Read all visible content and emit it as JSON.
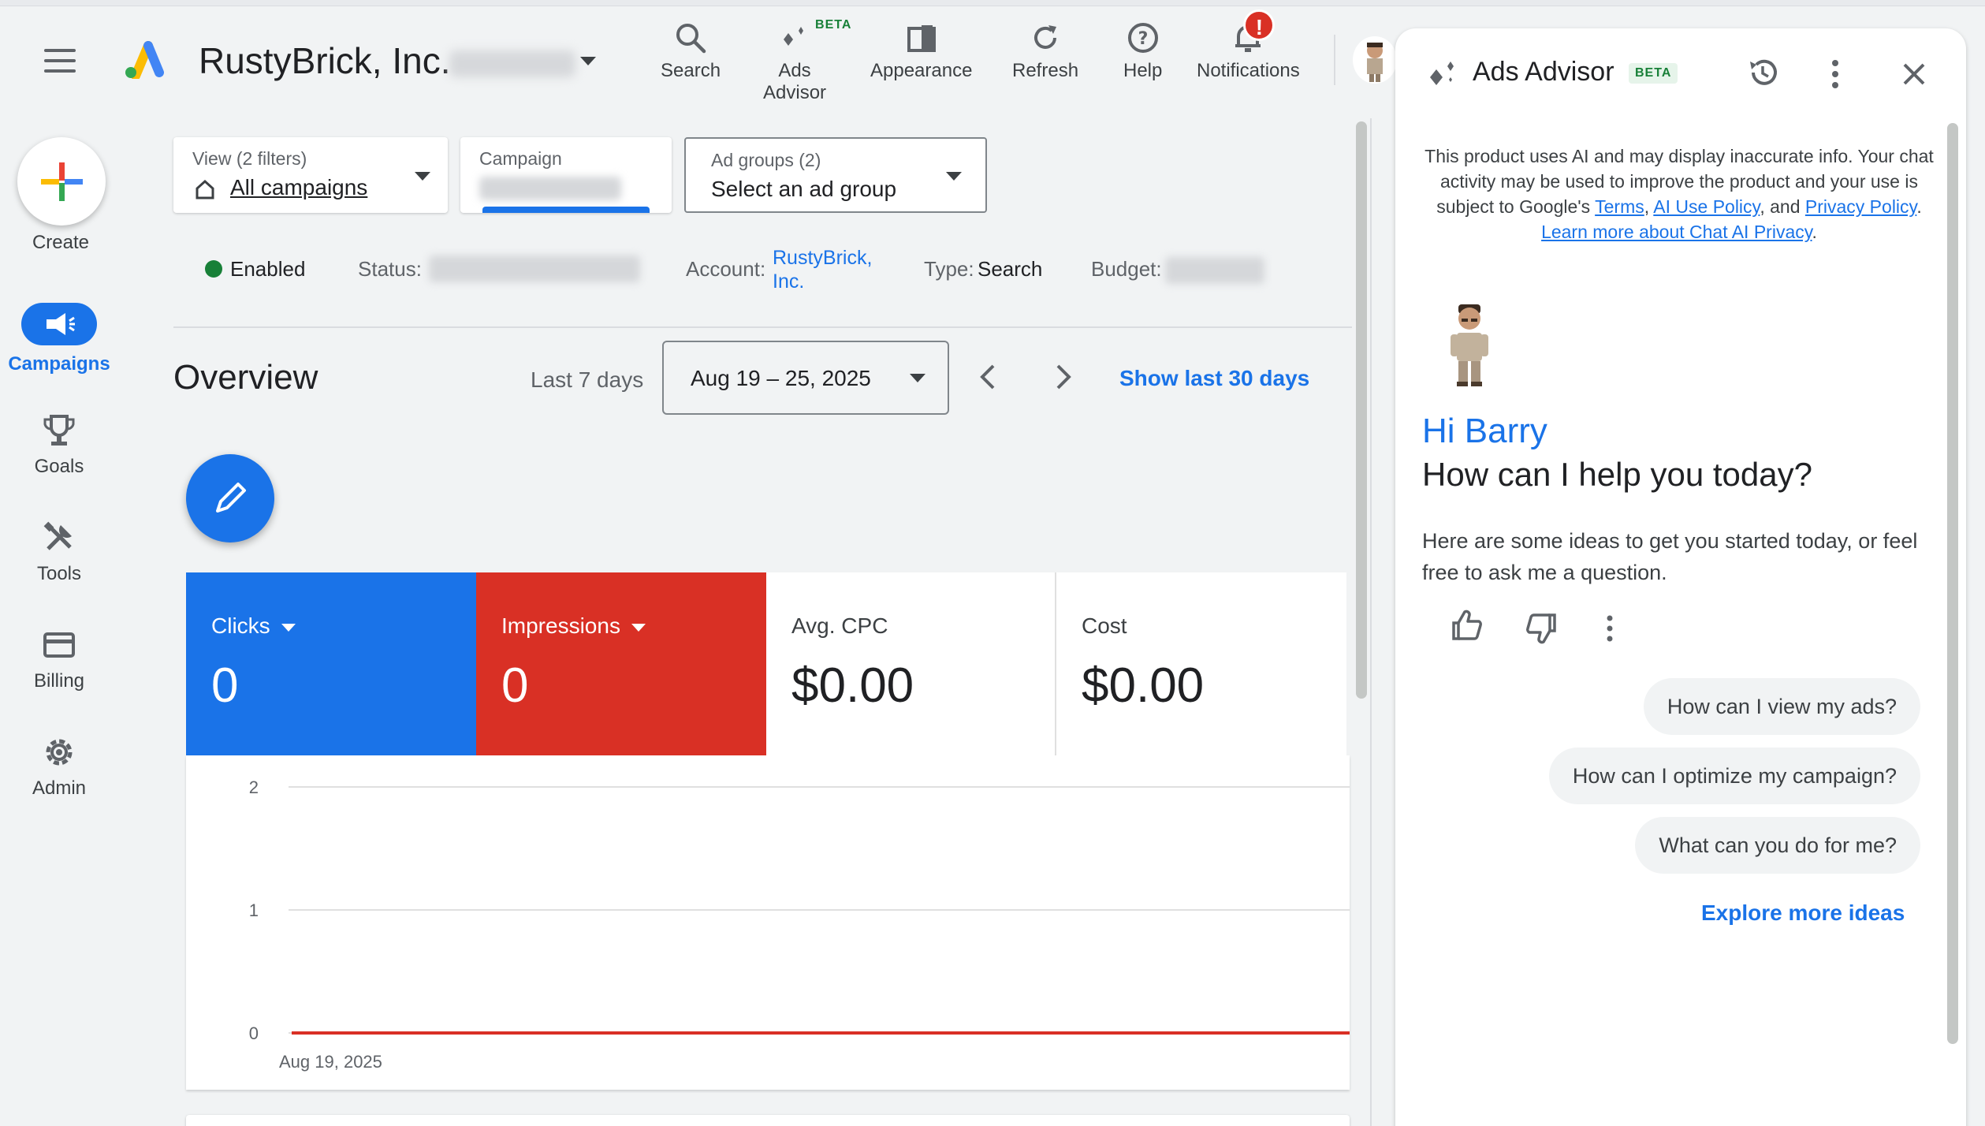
{
  "header": {
    "account_name": "RustyBrick, Inc.",
    "buttons": {
      "search": "Search",
      "ads_advisor_line1": "Ads",
      "ads_advisor_line2": "Advisor",
      "ads_advisor_badge": "BETA",
      "appearance": "Appearance",
      "refresh": "Refresh",
      "help": "Help",
      "notifications": "Notifications",
      "notifications_badge": "!"
    }
  },
  "nav": {
    "create": "Create",
    "campaigns": "Campaigns",
    "goals": "Goals",
    "tools": "Tools",
    "billing": "Billing",
    "admin": "Admin"
  },
  "filters": {
    "view_label": "View (2 filters)",
    "view_value": "All campaigns",
    "campaign_label": "Campaign",
    "adgroups_label": "Ad groups (2)",
    "adgroups_value": "Select an ad group"
  },
  "status_row": {
    "enabled": "Enabled",
    "status_label": "Status:",
    "account_label": "Account:",
    "account_value_line1": "RustyBrick,",
    "account_value_line2": "Inc.",
    "type_label": "Type:",
    "type_value": "Search",
    "budget_label": "Budget:"
  },
  "overview": {
    "title": "Overview",
    "range_label": "Last 7 days",
    "date_range": "Aug 19 – 25, 2025",
    "show_last_30": "Show last 30 days"
  },
  "metrics": [
    {
      "label": "Clicks",
      "value": "0"
    },
    {
      "label": "Impressions",
      "value": "0"
    },
    {
      "label": "Avg. CPC",
      "value": "$0.00"
    },
    {
      "label": "Cost",
      "value": "$0.00"
    }
  ],
  "chart_data": {
    "type": "line",
    "x": [
      "Aug 19, 2025"
    ],
    "y_ticks": [
      "2",
      "1",
      "0"
    ],
    "ylim": [
      0,
      2
    ],
    "series": [
      {
        "values": [
          0
        ],
        "color": "#d93025"
      }
    ],
    "grid": true
  },
  "advisor": {
    "title": "Ads Advisor",
    "beta": "BETA",
    "disclaimer": {
      "text1": "This product uses AI and may display inaccurate info. Your chat activity may be used to improve the product and your use is subject to Google's ",
      "terms": "Terms",
      "comma1": ", ",
      "ai_policy": "AI Use Policy",
      "text2": ", and ",
      "privacy": "Privacy Policy",
      "period": ". ",
      "learn_more": "Learn more about Chat AI Privacy",
      "end": "."
    },
    "greeting": "Hi Barry",
    "question": "How can I help you today?",
    "ideas_text": "Here are some ideas to get you started today, or feel free to ask me a question.",
    "suggestions": [
      "How can I view my ads?",
      "How can I optimize my campaign?",
      "What can you do for me?"
    ],
    "explore": "Explore more ideas"
  },
  "colors": {
    "blue": "#1a73e8",
    "red": "#d93025",
    "green": "#188038"
  }
}
